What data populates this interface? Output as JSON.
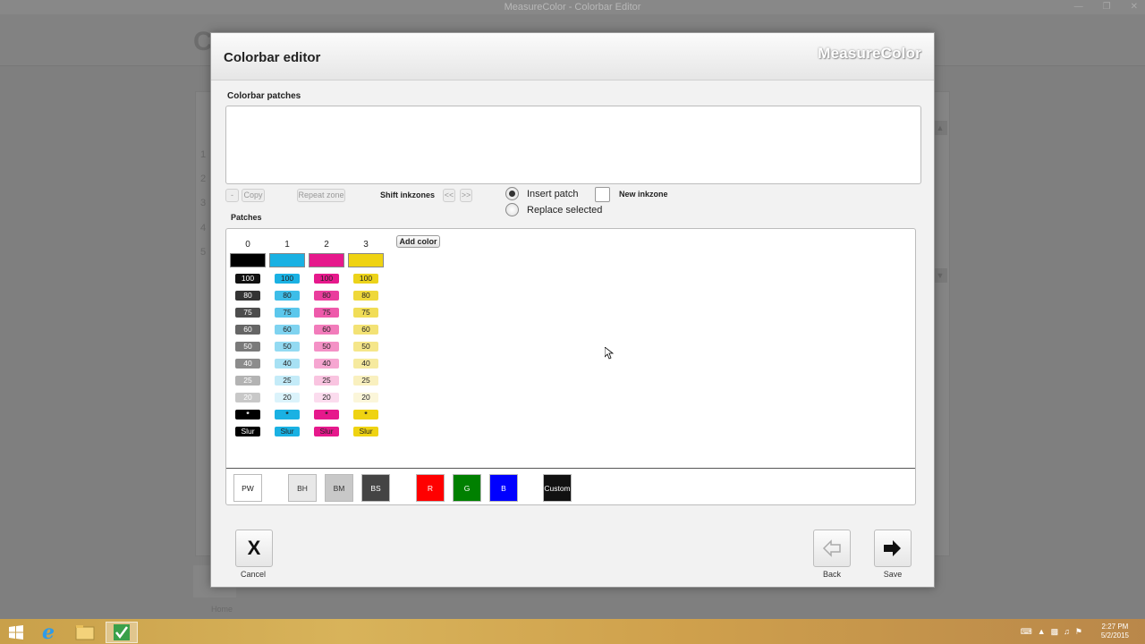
{
  "window": {
    "title": "MeasureColor - Colorbar Editor"
  },
  "background": {
    "row_numbers": [
      "1",
      "2",
      "3",
      "4",
      "5"
    ]
  },
  "dialog": {
    "title": "Colorbar editor",
    "brand": "MeasureColor",
    "colorbar_patches_label": "Colorbar patches",
    "toolbar": {
      "minus": "-",
      "copy": "Copy",
      "repeat_zone": "Repeat zone",
      "shift_inkzones": "Shift inkzones",
      "shift_left": "<<",
      "shift_right": ">>"
    },
    "insert_patch": "Insert patch",
    "replace_selected": "Replace selected",
    "new_inkzone": "New inkzone",
    "patches_label": "Patches",
    "add_color": "Add color",
    "columns": [
      {
        "index": "0",
        "color": "#000000",
        "text_dark": "#ffffff",
        "shades": [
          "#111111",
          "#333333",
          "#4d4d4d",
          "#666666",
          "#7a7a7a",
          "#8c8c8c",
          "#b3b3b3",
          "#c8c8c8"
        ]
      },
      {
        "index": "1",
        "color": "#1ab1e3",
        "text_dark": "#222222",
        "shades": [
          "#1ab1e3",
          "#3dbde8",
          "#5cc7ec",
          "#7fd3f0",
          "#93daf2",
          "#a7e1f4",
          "#c4ebf8",
          "#dbf3fb"
        ]
      },
      {
        "index": "2",
        "color": "#e6198c",
        "text_dark": "#222222",
        "shades": [
          "#e6198c",
          "#ea3d9d",
          "#ee5aab",
          "#f27cbb",
          "#f491c6",
          "#f6a6d1",
          "#f9c4e0",
          "#fbdcee"
        ]
      },
      {
        "index": "3",
        "color": "#efd312",
        "text_dark": "#222222",
        "shades": [
          "#ecd31a",
          "#efd83a",
          "#f1dd57",
          "#f3e275",
          "#f5e68a",
          "#f6ea9f",
          "#f9f0bf",
          "#fbf6da"
        ]
      }
    ],
    "percent_labels": [
      "100",
      "80",
      "75",
      "60",
      "50",
      "40",
      "25",
      "20"
    ],
    "star_label": "*",
    "slur_label": "Slur",
    "swatches": [
      {
        "label": "PW",
        "bg": "#ffffff",
        "fg": "#222222"
      },
      {
        "label": "BH",
        "bg": "#e8e8e8",
        "fg": "#333333"
      },
      {
        "label": "BM",
        "bg": "#c8c8c8",
        "fg": "#333333"
      },
      {
        "label": "BS",
        "bg": "#444444",
        "fg": "#ffffff"
      },
      {
        "label": "R",
        "bg": "#ff0000",
        "fg": "#ffffff"
      },
      {
        "label": "G",
        "bg": "#008000",
        "fg": "#ffffff"
      },
      {
        "label": "B",
        "bg": "#0000ff",
        "fg": "#ffffff"
      },
      {
        "label": "Custom",
        "bg": "#111111",
        "fg": "#ffffff"
      }
    ],
    "cancel_label": "Cancel",
    "back_label": "Back",
    "save_label": "Save"
  },
  "background_app": {
    "home_label": "Home"
  },
  "taskbar": {
    "time": "2:27 PM",
    "date": "5/2/2015"
  }
}
